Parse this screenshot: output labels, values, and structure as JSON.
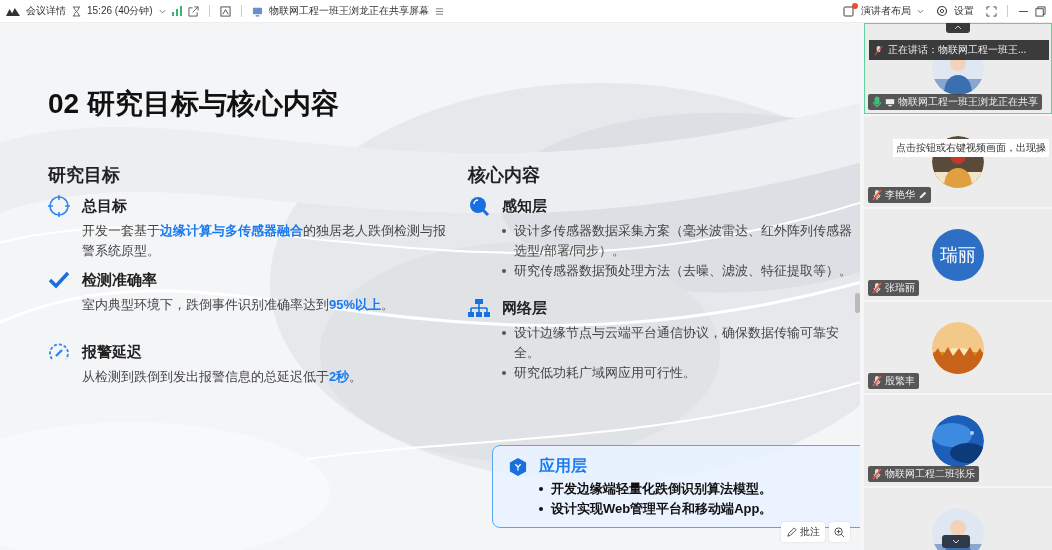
{
  "toolbar": {
    "meeting_details": "会议详情",
    "time": "15:26 (40分钟)",
    "sharing_status": "物联网工程一班王浏龙正在共享屏幕",
    "layout": "演讲者布局",
    "layout_notification": true,
    "settings": "设置"
  },
  "slide": {
    "title": "02 研究目标与核心内容",
    "goals": {
      "heading": "研究目标",
      "items": [
        {
          "kind": "target",
          "title": "总目标",
          "text": "开发一套基于**边缘计算与多传感器融合**的独居老人跌倒检测与报警系统原型。"
        },
        {
          "kind": "check",
          "title": "检测准确率",
          "text": "室内典型环境下，跌倒事件识别准确率达到**95%以上**。"
        },
        {
          "kind": "gauge",
          "title": "报警延迟",
          "text": "从检测到跌倒到发出报警信息的总延迟低于**2秒**。"
        }
      ]
    },
    "content": {
      "heading": "核心内容",
      "layers": [
        {
          "kind": "sensing",
          "title": "感知层",
          "bullets": [
            "设计多传感器数据采集方案（毫米波雷达、红外阵列传感器选型/部署/同步）。",
            "研究传感器数据预处理方法（去噪、滤波、特征提取等）。"
          ]
        },
        {
          "kind": "network",
          "title": "网络层",
          "bullets": [
            "设计边缘节点与云端平台通信协议，确保数据传输可靠安全。",
            "研究低功耗广域网应用可行性。"
          ]
        }
      ],
      "highlight": {
        "title": "应用层",
        "bullets": [
          "开发边缘端轻量化跌倒识别算法模型。",
          "设计实现Web管理平台和移动端App。"
        ]
      }
    },
    "annotate": "批注"
  },
  "participants": [
    {
      "name": "物联网工程一班王浏龙正在共享",
      "kind": "picture",
      "muted": false,
      "sharing": true,
      "annotating": false,
      "selected": true,
      "speaking": "正在讲话：物联网工程一班王..."
    },
    {
      "name": "李艳华",
      "kind": "picture",
      "muted": true,
      "sharing": false,
      "annotating": true,
      "selected": false,
      "tooltip": "点击按钮或右键视频画面，出现操"
    },
    {
      "name": "张瑞丽",
      "kind": "initials",
      "initials": "瑞丽",
      "muted": true,
      "sharing": false,
      "annotating": false,
      "selected": false
    },
    {
      "name": "殷繁丰",
      "kind": "picture",
      "muted": true,
      "sharing": false,
      "annotating": false,
      "selected": false
    },
    {
      "name": "物联网工程二班张乐",
      "kind": "picture",
      "muted": true,
      "sharing": false,
      "annotating": false,
      "selected": false
    },
    {
      "kind": "picture",
      "selected": false
    }
  ]
}
